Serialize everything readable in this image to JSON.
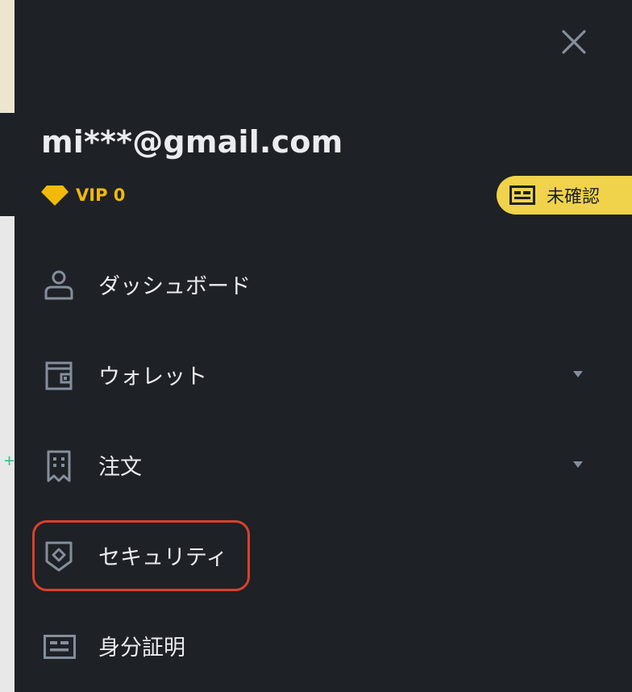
{
  "account": {
    "email": "mi***@gmail.com",
    "vip_level": "VIP 0",
    "verification_badge": "未確認"
  },
  "menu": {
    "items": [
      {
        "label": "ダッシュボード",
        "icon": "user-icon",
        "expandable": false
      },
      {
        "label": "ウォレット",
        "icon": "wallet-icon",
        "expandable": true
      },
      {
        "label": "注文",
        "icon": "receipt-icon",
        "expandable": true
      },
      {
        "label": "セキュリティ",
        "icon": "shield-icon",
        "expandable": false,
        "highlighted": true
      },
      {
        "label": "身分証明",
        "icon": "id-card-icon",
        "expandable": false
      }
    ]
  },
  "colors": {
    "drawer_bg": "#1e2126",
    "text": "#eaecef",
    "icon": "#848e9c",
    "vip_gold": "#f0b90b",
    "badge_bg": "#f0d34a",
    "highlight": "#d9412a"
  }
}
